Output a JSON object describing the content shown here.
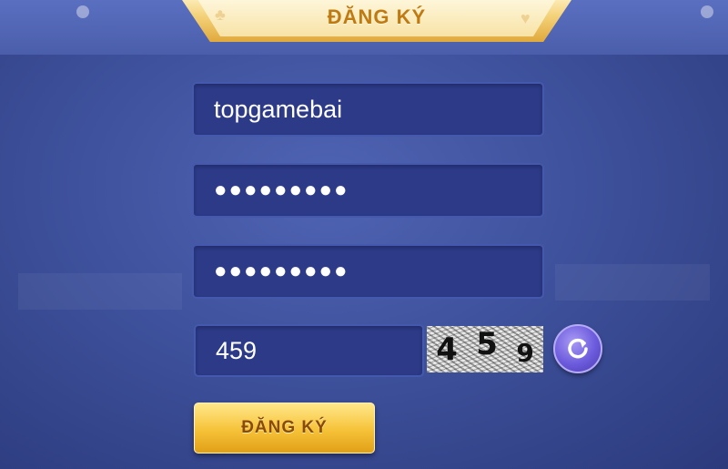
{
  "header": {
    "title": "ĐĂNG KÝ"
  },
  "form": {
    "username": "topgamebai",
    "password": "●●●●●●●●●",
    "confirm_password": "●●●●●●●●●",
    "captcha_input": "459"
  },
  "captcha": {
    "digits": [
      "4",
      "5",
      "9"
    ]
  },
  "submit": {
    "label": "ĐĂNG KÝ"
  },
  "icons": {
    "refresh": "refresh-icon",
    "header_left": "club-icon",
    "header_right": "heart-icon"
  },
  "colors": {
    "accent": "#f6c238",
    "field_bg": "#2c3a88",
    "title": "#c07a12"
  }
}
